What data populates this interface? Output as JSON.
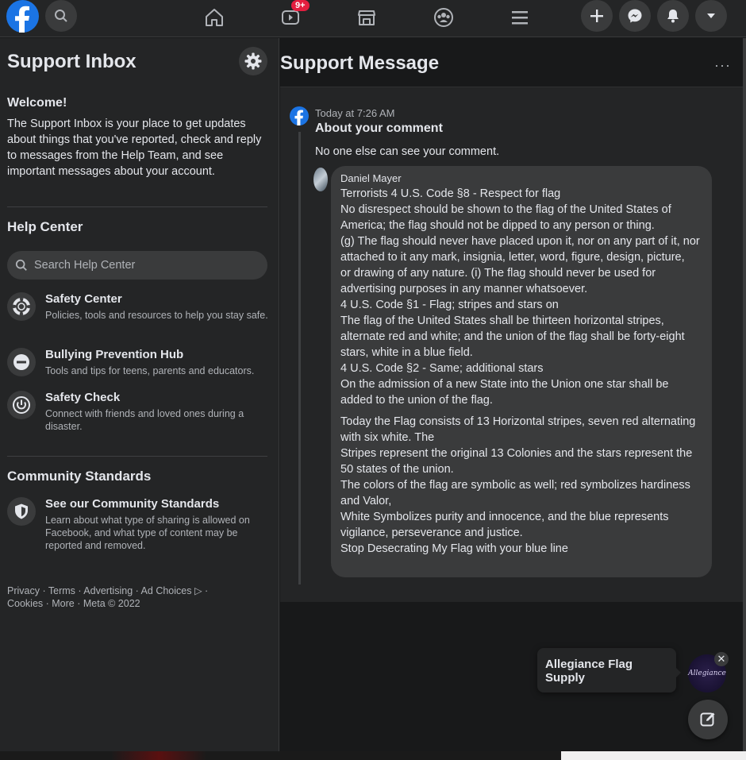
{
  "topbar": {
    "badge": "9+"
  },
  "sidebar": {
    "title": "Support Inbox",
    "welcome_heading": "Welcome!",
    "welcome_text": "The Support Inbox is your place to get updates about things that you've reported, check and reply to messages from the Help Team, and see important messages about your account.",
    "help_center_heading": "Help Center",
    "search_placeholder": "Search Help Center",
    "help_items": [
      {
        "title": "Safety Center",
        "desc": "Policies, tools and resources to help you stay safe."
      },
      {
        "title": "Bullying Prevention Hub",
        "desc": "Tools and tips for teens, parents and educators."
      },
      {
        "title": "Safety Check",
        "desc": "Connect with friends and loved ones during a disaster."
      }
    ],
    "community_heading": "Community Standards",
    "community_item": {
      "title": "See our Community Standards",
      "desc": "Learn about what type of sharing is allowed on Facebook, and what type of content may be reported and removed."
    },
    "footer_line1": "Privacy · Terms · Advertising · Ad Choices ▷ ·",
    "footer_line2": "Cookies · More · Meta © 2022"
  },
  "main": {
    "title": "Support Message",
    "more": "···",
    "timestamp": "Today at 7:26 AM",
    "message_title": "About your comment",
    "message_sub": "No one else can see your comment.",
    "comment": {
      "author": "Daniel Mayer",
      "lines": [
        "Terrorists 4 U.S. Code §8 - Respect for flag",
        "No disrespect should be shown to the flag of the United States of America; the flag should not be dipped to any person or thing.",
        "(g) The flag should never have placed upon it, nor on any part of it, nor attached to it any mark, insignia, letter, word, figure, design, picture,",
        "or drawing of any nature. (i) The flag should never be used for advertising purposes in any manner whatsoever.",
        "4 U.S. Code §1 - Flag; stripes and stars on",
        "The flag of the United States shall be thirteen horizontal stripes, alternate red and white; and the union of the flag shall be forty-eight stars, white in a blue field.",
        "4 U.S. Code §2 - Same; additional stars",
        "On the admission of a new State into the Union one star shall be added to the union of the flag.",
        "Today the Flag consists of 13 Horizontal stripes, seven red alternating with six white. The",
        "Stripes represent the original 13 Colonies and the stars represent the 50 states of the union.",
        "The colors of the flag are symbolic as well; red symbolizes hardiness and Valor,",
        "White Symbolizes purity and innocence, and the blue represents vigilance, perseverance and justice.",
        "Stop Desecrating My Flag with your blue line"
      ]
    }
  },
  "chat": {
    "popup_name": "Allegiance Flag Supply",
    "avatar_text": "Allegiance",
    "close": "✕"
  },
  "colors": {
    "brand": "#1b74e4",
    "background": "#18191a",
    "surface": "#242526",
    "badge": "#e41e3f"
  }
}
